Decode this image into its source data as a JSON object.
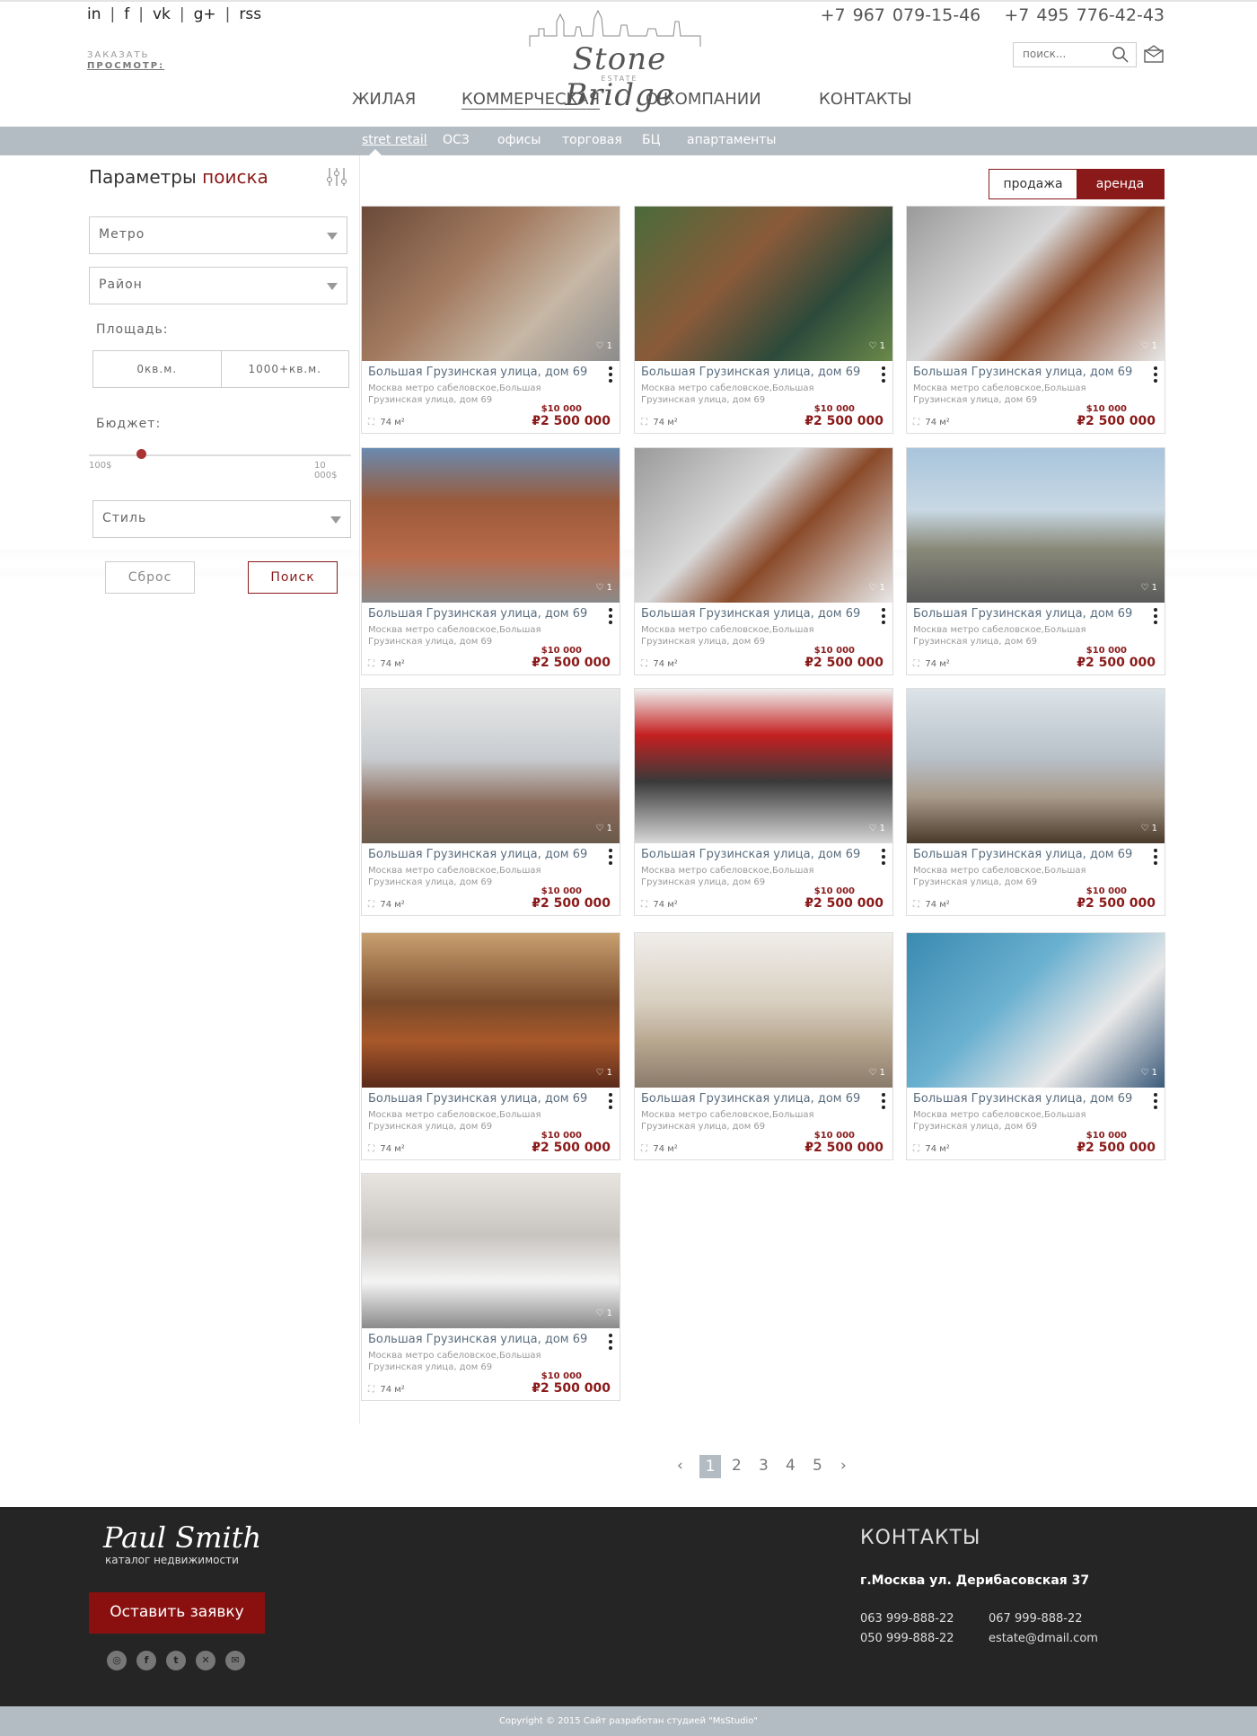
{
  "header": {
    "social": [
      "in",
      "f",
      "vk",
      "g+",
      "rss"
    ],
    "order_line1": "ЗАКАЗАТЬ",
    "order_line2": "ПРОСМОТР:",
    "logo": "Stone Bridge",
    "logo_sub": "ESTATE",
    "phone1": "+7 967 079-15-46",
    "phone2": "+7 495 776-42-43",
    "search_placeholder": "поиск..."
  },
  "nav": {
    "items": [
      "ЖИЛАЯ",
      "КОММЕРЧЕСКАЯ",
      "О КОМПАНИИ",
      "КОНТАКТЫ"
    ],
    "active": "КОММЕРЧЕСКАЯ"
  },
  "subnav": {
    "items": [
      "stret retail",
      "ОСЗ",
      "офисы",
      "торговая",
      "БЦ",
      "апартаменты"
    ],
    "active": "stret retail"
  },
  "sidebar": {
    "title": "Параметры",
    "title_accent": "поиска",
    "metro": "Метро",
    "district": "Район",
    "area_label": "Площадь:",
    "area_min": "0кв.м.",
    "area_max": "1000+кв.м.",
    "budget_label": "Бюджет:",
    "budget_min": "100$",
    "budget_max": "10 000$",
    "budget_value_fraction": 0.2,
    "style": "Стиль",
    "reset": "Сброс",
    "search": "Поиск"
  },
  "toggle": {
    "sale": "продажа",
    "rent": "аренда",
    "active": "аренда"
  },
  "cards": [
    {
      "title": "Большая Грузинская улица, дом 69",
      "addr": "Москва метро сабеловское,Большая Грузинская улица, дом 69",
      "size": "74 м²",
      "usd": "$10 000",
      "rub": "₽2 500 000",
      "likes": "1",
      "bg": "linear-gradient(135deg,#6b4a3a,#a27a5f 40%,#c7b7a5 70%,#8c8c8c)"
    },
    {
      "title": "Большая Грузинская улица, дом 69",
      "addr": "Москва метро сабеловское,Большая Грузинская улица, дом 69",
      "size": "74 м²",
      "usd": "$10 000",
      "rub": "₽2 500 000",
      "likes": "1",
      "bg": "linear-gradient(135deg,#4a6b3a,#8a5a3a 40%,#2c4a3a 70%,#6b8a4a)"
    },
    {
      "title": "Большая Грузинская улица, дом 69",
      "addr": "Москва метро сабеловское,Большая Грузинская улица, дом 69",
      "size": "74 м²",
      "usd": "$10 000",
      "rub": "₽2 500 000",
      "likes": "1",
      "bg": "linear-gradient(135deg,#9a9a9a,#d8d8d8 40%,#8a4a2a 60%,#e8e8e8)"
    },
    {
      "title": "Большая Грузинская улица, дом 69",
      "addr": "Москва метро сабеловское,Большая Грузинская улица, дом 69",
      "size": "74 м²",
      "usd": "$10 000",
      "rub": "₽2 500 000",
      "likes": "1",
      "bg": "linear-gradient(180deg,#6a8ab0,#9a5a3a 35%,#b86a4a 70%,#8a8a8a)"
    },
    {
      "title": "Большая Грузинская улица, дом 69",
      "addr": "Москва метро сабеловское,Большая Грузинская улица, дом 69",
      "size": "74 м²",
      "usd": "$10 000",
      "rub": "₽2 500 000",
      "likes": "1",
      "bg": "linear-gradient(135deg,#9a9a9a,#d8d8d8 40%,#8a4a2a 60%,#e8e8e8)"
    },
    {
      "title": "Большая Грузинская улица, дом 69",
      "addr": "Москва метро сабеловское,Большая Грузинская улица, дом 69",
      "size": "74 м²",
      "usd": "$10 000",
      "rub": "₽2 500 000",
      "likes": "1",
      "bg": "linear-gradient(180deg,#a8c4dc,#c8d8e4 40%,#8a8a7a 65%,#5a5a5a)"
    },
    {
      "title": "Большая Грузинская улица, дом 69",
      "addr": "Москва метро сабеловское,Большая Грузинская улица, дом 69",
      "size": "74 м²",
      "usd": "$10 000",
      "rub": "₽2 500 000",
      "likes": "1",
      "bg": "linear-gradient(180deg,#e8e8e8,#c8ccd0 45%,#8a6a5a 75%,#6a5a4a)"
    },
    {
      "title": "Большая Грузинская улица, дом 69",
      "addr": "Москва метро сабеловское,Большая Грузинская улица, дом 69",
      "size": "74 м²",
      "usd": "$10 000",
      "rub": "₽2 500 000",
      "likes": "1",
      "bg": "linear-gradient(180deg,#f0f0f0,#c42020 30%,#3a3a3a 60%,#d8d8d8)"
    },
    {
      "title": "Большая Грузинская улица, дом 69",
      "addr": "Москва метро сабеловское,Большая Грузинская улица, дом 69",
      "size": "74 м²",
      "usd": "$10 000",
      "rub": "₽2 500 000",
      "likes": "1",
      "bg": "linear-gradient(180deg,#dce4ea,#b8c0c8 45%,#a89a8a 70%,#4a3a2a)"
    },
    {
      "title": "Большая Грузинская улица, дом 69",
      "addr": "Москва метро сабеловское,Большая Грузинская улица, дом 69",
      "size": "74 м²",
      "usd": "$10 000",
      "rub": "₽2 500 000",
      "likes": "1",
      "bg": "linear-gradient(180deg,#c8a070,#7a4a2a 45%,#a8582a 70%,#5a2a1a)"
    },
    {
      "title": "Большая Грузинская улица, дом 69",
      "addr": "Москва метро сабеловское,Большая Грузинская улица, дом 69",
      "size": "74 м²",
      "usd": "$10 000",
      "rub": "₽2 500 000",
      "likes": "1",
      "bg": "linear-gradient(180deg,#f0eeea,#d8cfc0 45%,#b8a890 70%,#8a7a6a)"
    },
    {
      "title": "Большая Грузинская улица, дом 69",
      "addr": "Москва метро сабеловское,Большая Грузинская улица, дом 69",
      "size": "74 м²",
      "usd": "$10 000",
      "rub": "₽2 500 000",
      "likes": "1",
      "bg": "linear-gradient(135deg,#3a8ab0,#6ab0d0 40%,#e8e8e8 70%,#3a5a7a)"
    },
    {
      "title": "Большая Грузинская улица, дом 69",
      "addr": "Москва метро сабеловское,Большая Грузинская улица, дом 69",
      "size": "74 м²",
      "usd": "$10 000",
      "rub": "₽2 500 000",
      "likes": "1",
      "bg": "linear-gradient(180deg,#e8e4e0,#c8c4c0 40%,#f4f4f4 70%,#8a8a8a)"
    }
  ],
  "pager": {
    "prev": "‹",
    "pages": [
      "1",
      "2",
      "3",
      "4",
      "5"
    ],
    "current": "1",
    "next": "›"
  },
  "footer": {
    "logo": "Paul Smith",
    "sub": "каталог недвижимости",
    "button": "Оставить заявку",
    "icons": [
      "instagram-icon",
      "facebook-icon",
      "twitter-icon",
      "google-plus-icon",
      "mail-icon"
    ],
    "contacts_title": "КОНТАКТЫ",
    "address": "г.Москва  ул. Дерибасовская 37",
    "phone1": "063 999-888-22",
    "phone2": "067 999-888-22",
    "phone3": "050 999-888-22",
    "email": "estate@dmail.com"
  },
  "copyright": "Copyright © 2015  Сайт разработан студией \"MsStudio\""
}
